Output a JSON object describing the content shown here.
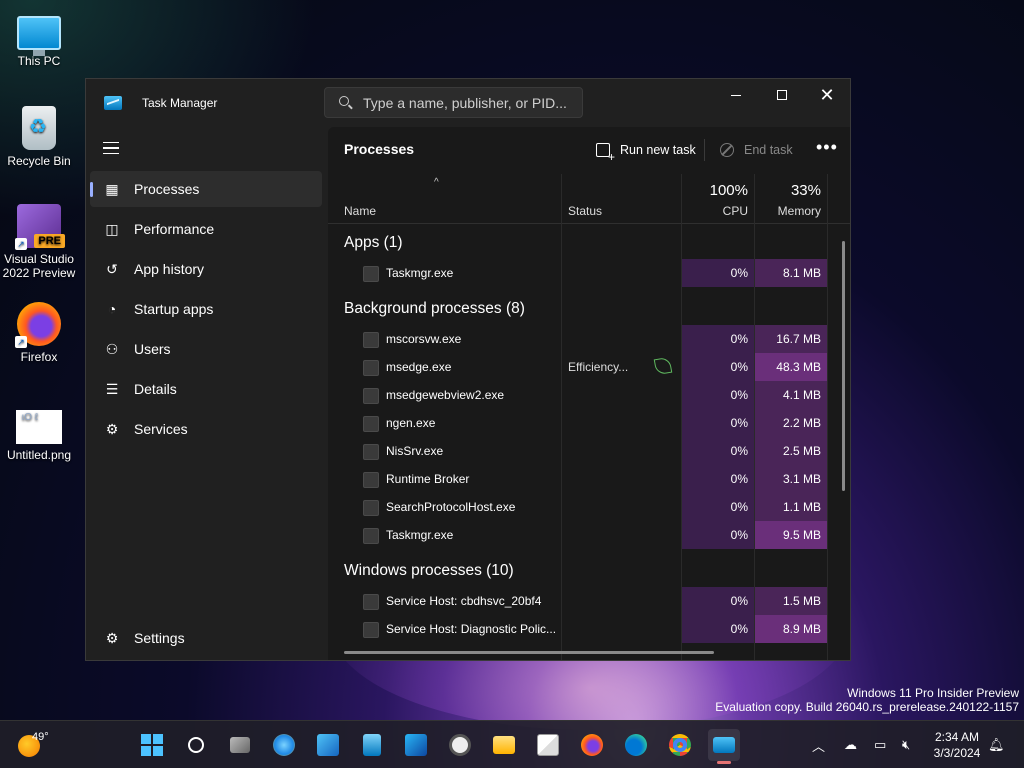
{
  "desktop": {
    "icons": [
      {
        "label": "This PC"
      },
      {
        "label": "Recycle Bin"
      },
      {
        "label_line1": "Visual Studio",
        "label_line2": "2022 Preview",
        "badge": "PRE"
      },
      {
        "label": "Firefox"
      },
      {
        "label": "Untitled.png"
      }
    ],
    "watermark_line1": "Windows 11 Pro Insider Preview",
    "watermark_line2": "Evaluation copy. Build 26040.rs_prerelease.240122-1157"
  },
  "window": {
    "title": "Task Manager",
    "search_placeholder": "Type a name, publisher, or PID...",
    "sidebar": {
      "items": [
        {
          "label": "Processes",
          "icon": "processes-icon",
          "active": true
        },
        {
          "label": "Performance",
          "icon": "performance-icon"
        },
        {
          "label": "App history",
          "icon": "history-icon"
        },
        {
          "label": "Startup apps",
          "icon": "startup-icon"
        },
        {
          "label": "Users",
          "icon": "users-icon"
        },
        {
          "label": "Details",
          "icon": "details-icon"
        },
        {
          "label": "Services",
          "icon": "services-icon"
        }
      ],
      "settings_label": "Settings"
    },
    "main": {
      "title": "Processes",
      "run_new_task": "Run new task",
      "end_task": "End task",
      "more": "•••",
      "columns": {
        "name": "Name",
        "status": "Status",
        "cpu_total": "100%",
        "cpu": "CPU",
        "mem_total": "33%",
        "memory": "Memory"
      },
      "groups": [
        {
          "title": "Apps (1)",
          "rows": [
            {
              "name": "Taskmgr.exe",
              "status": "",
              "cpu": "0%",
              "mem": "8.1 MB"
            }
          ]
        },
        {
          "title": "Background processes (8)",
          "rows": [
            {
              "name": "mscorsvw.exe",
              "status": "",
              "cpu": "0%",
              "mem": "16.7 MB"
            },
            {
              "name": "msedge.exe",
              "status": "Efficiency...",
              "cpu": "0%",
              "mem": "48.3 MB"
            },
            {
              "name": "msedgewebview2.exe",
              "status": "",
              "cpu": "0%",
              "mem": "4.1 MB"
            },
            {
              "name": "ngen.exe",
              "status": "",
              "cpu": "0%",
              "mem": "2.2 MB"
            },
            {
              "name": "NisSrv.exe",
              "status": "",
              "cpu": "0%",
              "mem": "2.5 MB"
            },
            {
              "name": "Runtime Broker",
              "status": "",
              "cpu": "0%",
              "mem": "3.1 MB"
            },
            {
              "name": "SearchProtocolHost.exe",
              "status": "",
              "cpu": "0%",
              "mem": "1.1 MB"
            },
            {
              "name": "Taskmgr.exe",
              "status": "",
              "cpu": "0%",
              "mem": "9.5 MB"
            }
          ]
        },
        {
          "title": "Windows processes (10)",
          "rows": [
            {
              "name": "Service Host: cbdhsvc_20bf4",
              "status": "",
              "cpu": "0%",
              "mem": "1.5 MB"
            },
            {
              "name": "Service Host: Diagnostic Polic...",
              "status": "",
              "cpu": "0%",
              "mem": "8.9 MB"
            }
          ]
        }
      ]
    }
  },
  "taskbar": {
    "weather_temp": "49°",
    "time": "2:34 AM",
    "date": "3/3/2024"
  },
  "colors": {
    "accent": "#4cc2ff",
    "heat_low": "#3a1f4c",
    "heat_mid": "#4a2558",
    "heat_high": "#6a2f7a"
  }
}
